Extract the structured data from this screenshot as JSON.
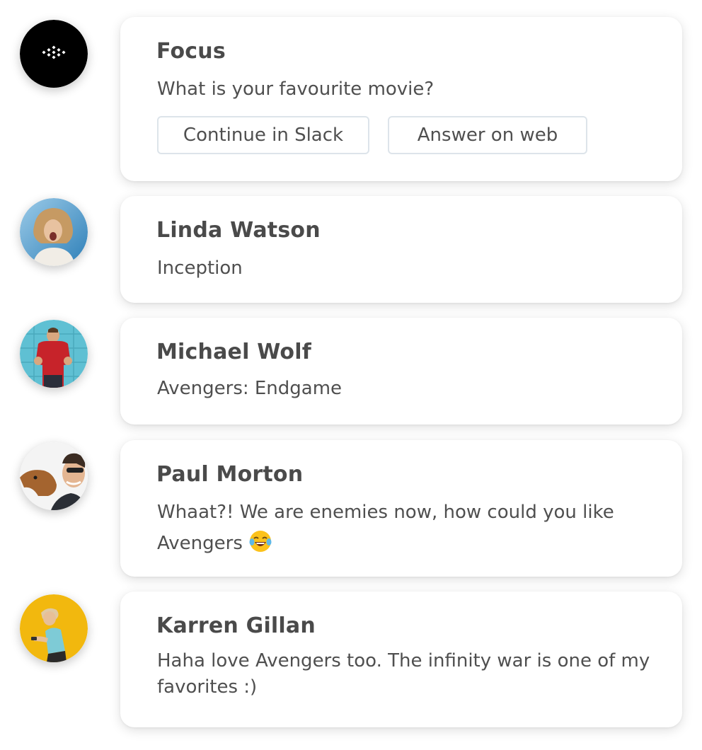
{
  "feed": [
    {
      "name": "Focus",
      "message": "What is your favourite movie?",
      "buttons": [
        "Continue in Slack",
        "Answer on web"
      ],
      "avatar_icon": "focus-logo-icon"
    },
    {
      "name": "Linda Watson",
      "message": "Inception",
      "avatar_icon": "linda-watson-avatar"
    },
    {
      "name": "Michael Wolf",
      "message": "Avengers: Endgame",
      "avatar_icon": "michael-wolf-avatar"
    },
    {
      "name": "Paul Morton",
      "message": "Whaat?! We are enemies now, how could you like Avengers",
      "emoji": "laughing-crying-emoji",
      "avatar_icon": "paul-morton-avatar"
    },
    {
      "name": "Karren Gillan",
      "message": "Haha love Avengers too. The infinity war is one of my favorites :)",
      "avatar_icon": "karren-gillan-avatar"
    }
  ],
  "colors": {
    "text": "#4a4a4a",
    "card_bg": "#ffffff",
    "button_border": "#dde4ea",
    "focus_logo_bg": "#000000"
  }
}
